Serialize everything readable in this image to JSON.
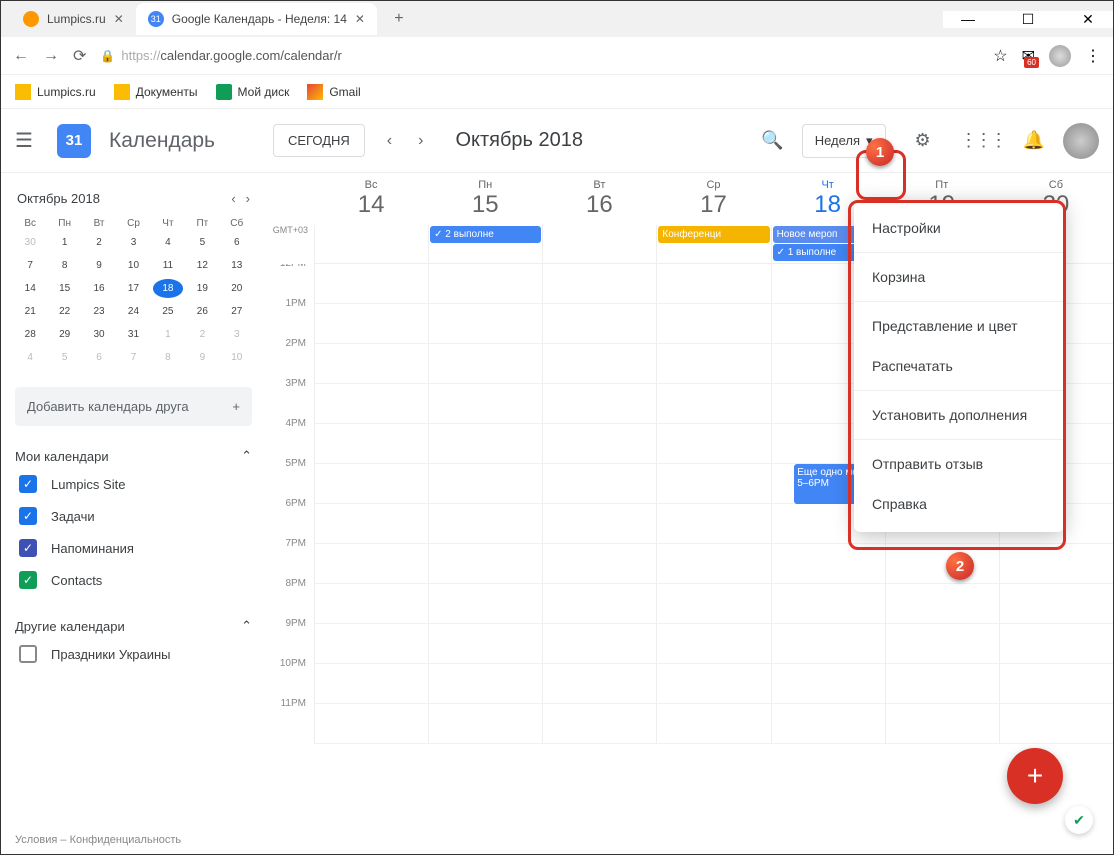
{
  "window": {
    "minimize": "—",
    "maximize": "☐",
    "close": "✕"
  },
  "tabs": [
    {
      "favclass": "fav-orange",
      "label": "Lumpics.ru",
      "active": false
    },
    {
      "favclass": "fav-blue",
      "favtext": "31",
      "label": "Google Календарь - Неделя: 14",
      "active": true
    }
  ],
  "addr": {
    "back": "←",
    "forward": "→",
    "reload": "⟳",
    "lock": "🔒",
    "url_prefix": "https://",
    "url_body": "calendar.google.com/calendar/r",
    "star": "☆",
    "gmail_count": "60",
    "more": "⋮"
  },
  "bookmarks": [
    {
      "icon": "y",
      "label": "Lumpics.ru"
    },
    {
      "icon": "y",
      "label": "Документы"
    },
    {
      "icon": "g",
      "label": "Мой диск"
    },
    {
      "icon": "m",
      "label": "Gmail"
    }
  ],
  "header": {
    "menu": "☰",
    "logo_day": "31",
    "title": "Календарь",
    "today": "СЕГОДНЯ",
    "prev": "‹",
    "next": "›",
    "month": "Октябрь 2018",
    "search": "🔍",
    "view": "Неделя",
    "view_chevron": "▾",
    "gear": "⚙",
    "apps": "⋮⋮⋮",
    "bell": "🔔"
  },
  "minical": {
    "title": "Октябрь 2018",
    "prev": "‹",
    "next": "›",
    "daynames": [
      "Вс",
      "Пн",
      "Вт",
      "Ср",
      "Чт",
      "Пт",
      "Сб"
    ],
    "rows": [
      [
        {
          "n": "30",
          "dim": true
        },
        {
          "n": "1"
        },
        {
          "n": "2"
        },
        {
          "n": "3"
        },
        {
          "n": "4"
        },
        {
          "n": "5"
        },
        {
          "n": "6"
        }
      ],
      [
        {
          "n": "7"
        },
        {
          "n": "8"
        },
        {
          "n": "9"
        },
        {
          "n": "10"
        },
        {
          "n": "11"
        },
        {
          "n": "12"
        },
        {
          "n": "13"
        }
      ],
      [
        {
          "n": "14"
        },
        {
          "n": "15"
        },
        {
          "n": "16"
        },
        {
          "n": "17"
        },
        {
          "n": "18",
          "today": true
        },
        {
          "n": "19"
        },
        {
          "n": "20"
        }
      ],
      [
        {
          "n": "21"
        },
        {
          "n": "22"
        },
        {
          "n": "23"
        },
        {
          "n": "24"
        },
        {
          "n": "25"
        },
        {
          "n": "26"
        },
        {
          "n": "27"
        }
      ],
      [
        {
          "n": "28"
        },
        {
          "n": "29"
        },
        {
          "n": "30"
        },
        {
          "n": "31"
        },
        {
          "n": "1",
          "dim": true
        },
        {
          "n": "2",
          "dim": true
        },
        {
          "n": "3",
          "dim": true
        }
      ],
      [
        {
          "n": "4",
          "dim": true
        },
        {
          "n": "5",
          "dim": true
        },
        {
          "n": "6",
          "dim": true
        },
        {
          "n": "7",
          "dim": true
        },
        {
          "n": "8",
          "dim": true
        },
        {
          "n": "9",
          "dim": true
        },
        {
          "n": "10",
          "dim": true
        }
      ]
    ]
  },
  "sidebar": {
    "add_friend": "Добавить календарь друга",
    "plus": "+",
    "my_cal": "Мои календари",
    "chevron": "⌃",
    "my_cals": [
      {
        "color": "#1a73e8",
        "label": "Lumpics Site",
        "checked": true
      },
      {
        "color": "#1a73e8",
        "label": "Задачи",
        "checked": true
      },
      {
        "color": "#3f51b5",
        "label": "Напоминания",
        "checked": true
      },
      {
        "color": "#0f9d58",
        "label": "Contacts",
        "checked": true
      }
    ],
    "other_cal": "Другие календари",
    "other_cals": [
      {
        "color": "",
        "label": "Праздники Украины",
        "checked": false
      }
    ],
    "footer": "Условия – Конфиденциальность"
  },
  "days": [
    {
      "name": "Вс",
      "num": "14",
      "today": false
    },
    {
      "name": "Пн",
      "num": "15",
      "today": false
    },
    {
      "name": "Вт",
      "num": "16",
      "today": false
    },
    {
      "name": "Ср",
      "num": "17",
      "today": false
    },
    {
      "name": "Чт",
      "num": "18",
      "today": true
    },
    {
      "name": "Пт",
      "num": "19",
      "today": false
    },
    {
      "name": "Сб",
      "num": "20",
      "today": false
    }
  ],
  "timezone": "GMT+03",
  "allday": {
    "1": [
      {
        "cls": "chip-blue",
        "text": "✓ 2 выполне"
      }
    ],
    "3": [
      {
        "cls": "chip-orange",
        "text": "Конференци"
      }
    ],
    "4": [
      {
        "cls": "chip-blue2",
        "text": "Новое мероп"
      },
      {
        "cls": "chip-blue",
        "text": "✓ 1 выполне"
      }
    ],
    "5": [
      {
        "cls": "chip-blue",
        "text": "✓"
      }
    ]
  },
  "hours": [
    "12PM",
    "1PM",
    "2PM",
    "3PM",
    "4PM",
    "5PM",
    "6PM",
    "7PM",
    "8PM",
    "9PM",
    "10PM",
    "11PM"
  ],
  "timed_event": {
    "title": "Еще одно мер",
    "time": "5–6PM"
  },
  "fab": "+",
  "shield": "✔",
  "popup": [
    {
      "label": "Настройки"
    },
    {
      "sep": true
    },
    {
      "label": "Корзина"
    },
    {
      "sep": true
    },
    {
      "label": "Представление и цвет"
    },
    {
      "label": "Распечатать"
    },
    {
      "sep": true
    },
    {
      "label": "Установить дополнения"
    },
    {
      "sep": true
    },
    {
      "label": "Отправить отзыв"
    },
    {
      "label": "Справка"
    }
  ],
  "annot": {
    "1": "1",
    "2": "2"
  }
}
